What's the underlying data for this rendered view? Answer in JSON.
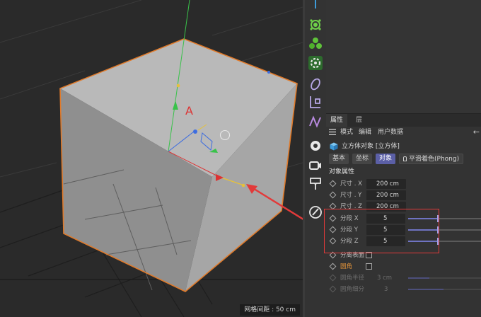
{
  "viewport": {
    "grid_spacing_label": "网格间距 : 50 cm"
  },
  "toolbar": {
    "icons": [
      "spline-icon",
      "nurbs-generator-icon",
      "cloner-icon",
      "deformer-gear-icon",
      "camera-object-icon",
      "field-icon",
      "mograph-icon",
      "light-icon",
      "tag-icon",
      "render-icon",
      "brush-icon"
    ]
  },
  "panel": {
    "tabs": [
      "属性",
      "层"
    ],
    "menu": [
      "模式",
      "编辑",
      "用户数据"
    ],
    "back_arrow": "←",
    "object_title": "立方体对象 [立方体]",
    "subtabs": [
      "基本",
      "坐标",
      "对象"
    ],
    "phong_tab": "平滑着色(Phong)",
    "section_title": "对象属性",
    "size_rows": [
      {
        "label": "尺寸 . X",
        "value": "200 cm"
      },
      {
        "label": "尺寸 . Y",
        "value": "200 cm"
      },
      {
        "label": "尺寸 . Z",
        "value": "200 cm"
      }
    ],
    "segment_rows": [
      {
        "label": "分段 X",
        "value": "5"
      },
      {
        "label": "分段 Y",
        "value": "5"
      },
      {
        "label": "分段 Z",
        "value": "5"
      }
    ],
    "separate_surfaces": "分离表面",
    "fillet": "圆角",
    "fillet_radius": {
      "label": "圆角半径",
      "value": "3 cm"
    },
    "fillet_subdivision": {
      "label": "圆角细分",
      "value": "3"
    }
  },
  "colors": {
    "accent": "#5b5fa6",
    "highlight": "#e23a3a",
    "selection_outline": "#e07a2a",
    "fillet_label": "#e0923a"
  }
}
